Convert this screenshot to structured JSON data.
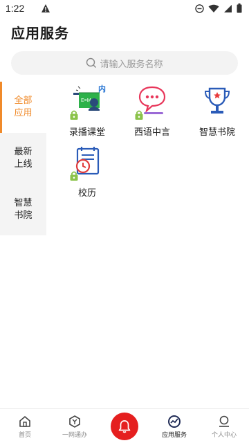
{
  "status_bar": {
    "time": "1:22"
  },
  "header": {
    "title": "应用服务"
  },
  "search": {
    "placeholder": "请输入服务名称"
  },
  "sidebar": {
    "items": [
      {
        "label": "全部\n应用",
        "active": true
      },
      {
        "label": "最新\n上线",
        "active": false
      },
      {
        "label": "智慧\n书院",
        "active": false
      }
    ]
  },
  "apps": [
    {
      "label": "录播课堂",
      "icon": "video-classroom-icon",
      "badge": "内",
      "locked": true
    },
    {
      "label": "西语中言",
      "icon": "chat-bubble-icon",
      "locked": true
    },
    {
      "label": "智慧书院",
      "icon": "trophy-icon",
      "locked": false
    },
    {
      "label": "校历",
      "icon": "calendar-clock-icon",
      "locked": true
    }
  ],
  "bottom_nav": {
    "items": [
      {
        "label": "首页",
        "icon": "home-icon"
      },
      {
        "label": "一网通办",
        "icon": "hexagon-icon"
      },
      {
        "label": "",
        "icon": "bell-icon"
      },
      {
        "label": "应用服务",
        "icon": "app-services-icon",
        "active": true
      },
      {
        "label": "个人中心",
        "icon": "person-icon"
      }
    ]
  },
  "colors": {
    "accent": "#f08a2a",
    "bell": "#e51f1f",
    "lock": "#8bc34a"
  }
}
